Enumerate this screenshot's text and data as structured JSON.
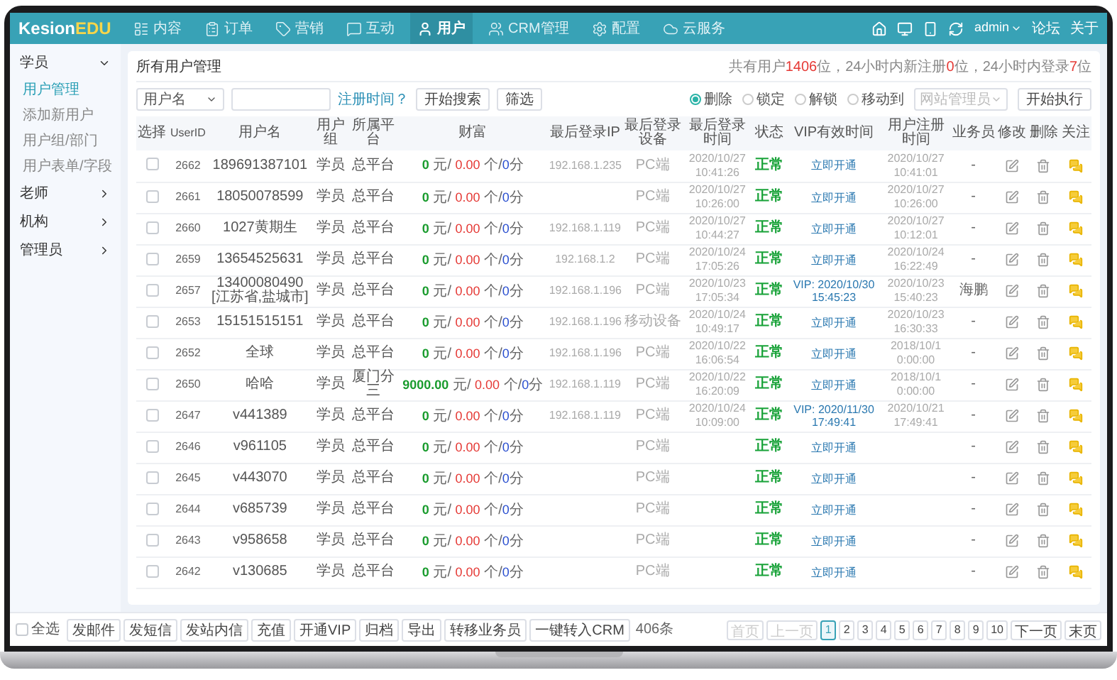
{
  "top_bar": {
    "logo": {
      "first": "Kesion",
      "second": "EDU"
    },
    "nav": [
      {
        "label": "内容",
        "selected": false
      },
      {
        "label": "订单",
        "selected": false
      },
      {
        "label": "营销",
        "selected": false
      },
      {
        "label": "互动",
        "selected": false
      },
      {
        "label": "用户",
        "selected": true
      },
      {
        "label": "CRM管理",
        "selected": false
      },
      {
        "label": "配置",
        "selected": false
      },
      {
        "label": "云服务",
        "selected": false
      }
    ],
    "user": "admin",
    "links": [
      "论坛",
      "关于"
    ]
  },
  "sidebar": [
    {
      "label": "学员",
      "expanded": true,
      "children": [
        {
          "label": "用户管理",
          "selected": true
        },
        {
          "label": "添加新用户",
          "selected": false
        },
        {
          "label": "用户组/部门",
          "selected": false
        },
        {
          "label": "用户表单/字段",
          "selected": false
        }
      ]
    },
    {
      "label": "老师",
      "expanded": false
    },
    {
      "label": "机构",
      "expanded": false
    },
    {
      "label": "管理员",
      "expanded": false
    }
  ],
  "page_title": "所有用户管理",
  "summary": [
    {
      "text": "共有用户",
      "highlight": false
    },
    {
      "text": "1406",
      "highlight": true
    },
    {
      "text": "位，24小时内新注册",
      "highlight": false
    },
    {
      "text": "0",
      "highlight": true
    },
    {
      "text": "位，24小时内登录",
      "highlight": false
    },
    {
      "text": "7",
      "highlight": true
    },
    {
      "text": "位",
      "highlight": false
    }
  ],
  "search": {
    "field": "用户名",
    "date_link": "注册时间？",
    "buttons": [
      "开始搜索",
      "筛选"
    ]
  },
  "batch": {
    "actions": [
      {
        "label": "删除",
        "selected": true
      },
      {
        "label": "锁定",
        "selected": false
      },
      {
        "label": "解锁",
        "selected": false
      },
      {
        "label": "移动到",
        "selected": false
      }
    ],
    "target": "网站管理员",
    "button": "开始执行"
  },
  "table": {
    "columns": [
      "选择",
      "UserID",
      "用户名",
      "用户组",
      "所属平台",
      "财富",
      "最后登录IP",
      "最后登录设备",
      "最后登录时间",
      "状态",
      "VIP有效时间",
      "用户注册时间",
      "业务员",
      "修改",
      "删除",
      "关注"
    ],
    "rows": [
      {
        "checked": false,
        "id": "2662",
        "username": "189691387101",
        "group": "学员",
        "platform": "总平台",
        "wealth": [
          "0",
          " 元/ ",
          "0.00",
          " 个/",
          "0",
          "分"
        ],
        "ip": "192.168.1.235",
        "device": "PC端",
        "last_login": "2020/10/27 10:41:26",
        "status": "正常",
        "vip": "立即开通",
        "registered": "2020/10/27 10:41:01",
        "agent": "-"
      },
      {
        "checked": false,
        "id": "2661",
        "username": "18050078599",
        "group": "学员",
        "platform": "总平台",
        "wealth": [
          "0",
          " 元/ ",
          "0.00",
          " 个/",
          "0",
          "分"
        ],
        "device": "PC端",
        "last_login": "2020/10/27 10:26:00",
        "status": "正常",
        "vip": "立即开通",
        "registered": "2020/10/27 10:26:00",
        "agent": "-"
      },
      {
        "checked": false,
        "id": "2660",
        "username": "1027黄期生",
        "group": "学员",
        "platform": "总平台",
        "wealth": [
          "0",
          " 元/ ",
          "0.00",
          " 个/",
          "0",
          "分"
        ],
        "ip": "192.168.1.119",
        "device": "PC端",
        "last_login": "2020/10/27 10:44:27",
        "status": "正常",
        "vip": "立即开通",
        "registered": "2020/10/27 10:12:01",
        "agent": "-"
      },
      {
        "checked": false,
        "id": "2659",
        "username": "13654525631",
        "group": "学员",
        "platform": "总平台",
        "wealth": [
          "0",
          " 元/ ",
          "0.00",
          " 个/",
          "0",
          "分"
        ],
        "ip": "192.168.1.2",
        "device": "PC端",
        "last_login": "2020/10/24 17:05:26",
        "status": "正常",
        "vip": "立即开通",
        "registered": "2020/10/24 16:22:49",
        "agent": "-"
      },
      {
        "checked": false,
        "id": "2657",
        "username": "13400080490[江苏省,盐城市]",
        "group": "学员",
        "platform": "总平台",
        "wealth": [
          "0",
          " 元/ ",
          "0.00",
          " 个/",
          "0",
          "分"
        ],
        "ip": "192.168.1.196",
        "device": "PC端",
        "last_login": "2020/10/23 17:05:34",
        "status": "正常",
        "vip": "VIP: 2020/10/30 15:45:23",
        "registered": "2020/10/23 15:40:23",
        "agent": "海鹏"
      },
      {
        "checked": false,
        "id": "2653",
        "username": "15151515151",
        "group": "学员",
        "platform": "总平台",
        "wealth": [
          "0",
          " 元/ ",
          "0.00",
          " 个/",
          "0",
          "分"
        ],
        "ip": "192.168.1.196",
        "device": "移动设备",
        "last_login": "2020/10/24 10:49:17",
        "status": "正常",
        "vip": "立即开通",
        "registered": "2020/10/23 16:30:33",
        "agent": "-"
      },
      {
        "checked": false,
        "id": "2652",
        "username": "全球",
        "group": "学员",
        "platform": "总平台",
        "wealth": [
          "0",
          " 元/ ",
          "0.00",
          " 个/",
          "0",
          "分"
        ],
        "ip": "192.168.1.196",
        "device": "PC端",
        "last_login": "2020/10/22 16:06:54",
        "status": "正常",
        "vip": "立即开通",
        "registered": "2018/10/1 0:00:00",
        "agent": "-"
      },
      {
        "checked": false,
        "id": "2650",
        "username": "哈哈",
        "group": "学员",
        "platform": "厦门分三",
        "wealth": [
          "9000.00",
          " 元/ ",
          "0.00",
          " 个/",
          "0",
          "分"
        ],
        "ip": "192.168.1.119",
        "device": "PC端",
        "last_login": "2020/10/22 16:20:09",
        "status": "正常",
        "vip": "立即开通",
        "registered": "2018/10/1 0:00:00",
        "agent": "-"
      },
      {
        "checked": false,
        "id": "2647",
        "username": "v441389",
        "group": "学员",
        "platform": "总平台",
        "wealth": [
          "0",
          " 元/ ",
          "0.00",
          " 个/",
          "0",
          "分"
        ],
        "ip": "192.168.1.119",
        "device": "PC端",
        "last_login": "2020/10/24 10:09:00",
        "status": "正常",
        "vip": "VIP: 2020/11/30 17:49:41",
        "registered": "2020/10/21 17:49:41",
        "agent": "-"
      },
      {
        "checked": false,
        "id": "2646",
        "username": "v961105",
        "group": "学员",
        "platform": "总平台",
        "wealth": [
          "0",
          " 元/ ",
          "0.00",
          " 个/",
          "0",
          "分"
        ],
        "device": "PC端",
        "status": "正常",
        "vip": "立即开通",
        "agent": "-"
      },
      {
        "checked": false,
        "id": "2645",
        "username": "v443070",
        "group": "学员",
        "platform": "总平台",
        "wealth": [
          "0",
          " 元/ ",
          "0.00",
          " 个/",
          "0",
          "分"
        ],
        "device": "PC端",
        "status": "正常",
        "vip": "立即开通",
        "agent": "-"
      },
      {
        "checked": false,
        "id": "2644",
        "username": "v685739",
        "group": "学员",
        "platform": "总平台",
        "wealth": [
          "0",
          " 元/ ",
          "0.00",
          " 个/",
          "0",
          "分"
        ],
        "device": "PC端",
        "status": "正常",
        "vip": "立即开通",
        "agent": "-"
      },
      {
        "checked": false,
        "id": "2643",
        "username": "v958658",
        "group": "学员",
        "platform": "总平台",
        "wealth": [
          "0",
          " 元/ ",
          "0.00",
          " 个/",
          "0",
          "分"
        ],
        "device": "PC端",
        "status": "正常",
        "vip": "立即开通",
        "agent": "-"
      },
      {
        "checked": false,
        "id": "2642",
        "username": "v130685",
        "group": "学员",
        "platform": "总平台",
        "wealth": [
          "0",
          " 元/ ",
          "0.00",
          " 个/",
          "0",
          "分"
        ],
        "device": "PC端",
        "status": "正常",
        "vip": "立即开通",
        "agent": "-"
      }
    ]
  },
  "footer": {
    "select_all": {
      "label": "全选",
      "checked": false
    },
    "actions": [
      "发邮件",
      "发短信",
      "发站内信",
      "充值",
      "开通VIP",
      "归档",
      "导出",
      "转移业务员",
      "一键转入CRM"
    ],
    "total": "406条",
    "pages": [
      {
        "label": "首页",
        "selected": false,
        "disabled": true
      },
      {
        "label": "上一页",
        "selected": false,
        "disabled": true
      },
      {
        "label": "1",
        "selected": true,
        "disabled": false
      },
      {
        "label": "2",
        "selected": false,
        "disabled": false
      },
      {
        "label": "3",
        "selected": false,
        "disabled": false
      },
      {
        "label": "4",
        "selected": false,
        "disabled": false
      },
      {
        "label": "5",
        "selected": false,
        "disabled": false
      },
      {
        "label": "6",
        "selected": false,
        "disabled": false
      },
      {
        "label": "7",
        "selected": false,
        "disabled": false
      },
      {
        "label": "8",
        "selected": false,
        "disabled": false
      },
      {
        "label": "9",
        "selected": false,
        "disabled": false
      },
      {
        "label": "10",
        "selected": false,
        "disabled": false
      },
      {
        "label": "下一页",
        "selected": false,
        "disabled": false
      },
      {
        "label": "末页",
        "selected": false,
        "disabled": false
      }
    ]
  }
}
